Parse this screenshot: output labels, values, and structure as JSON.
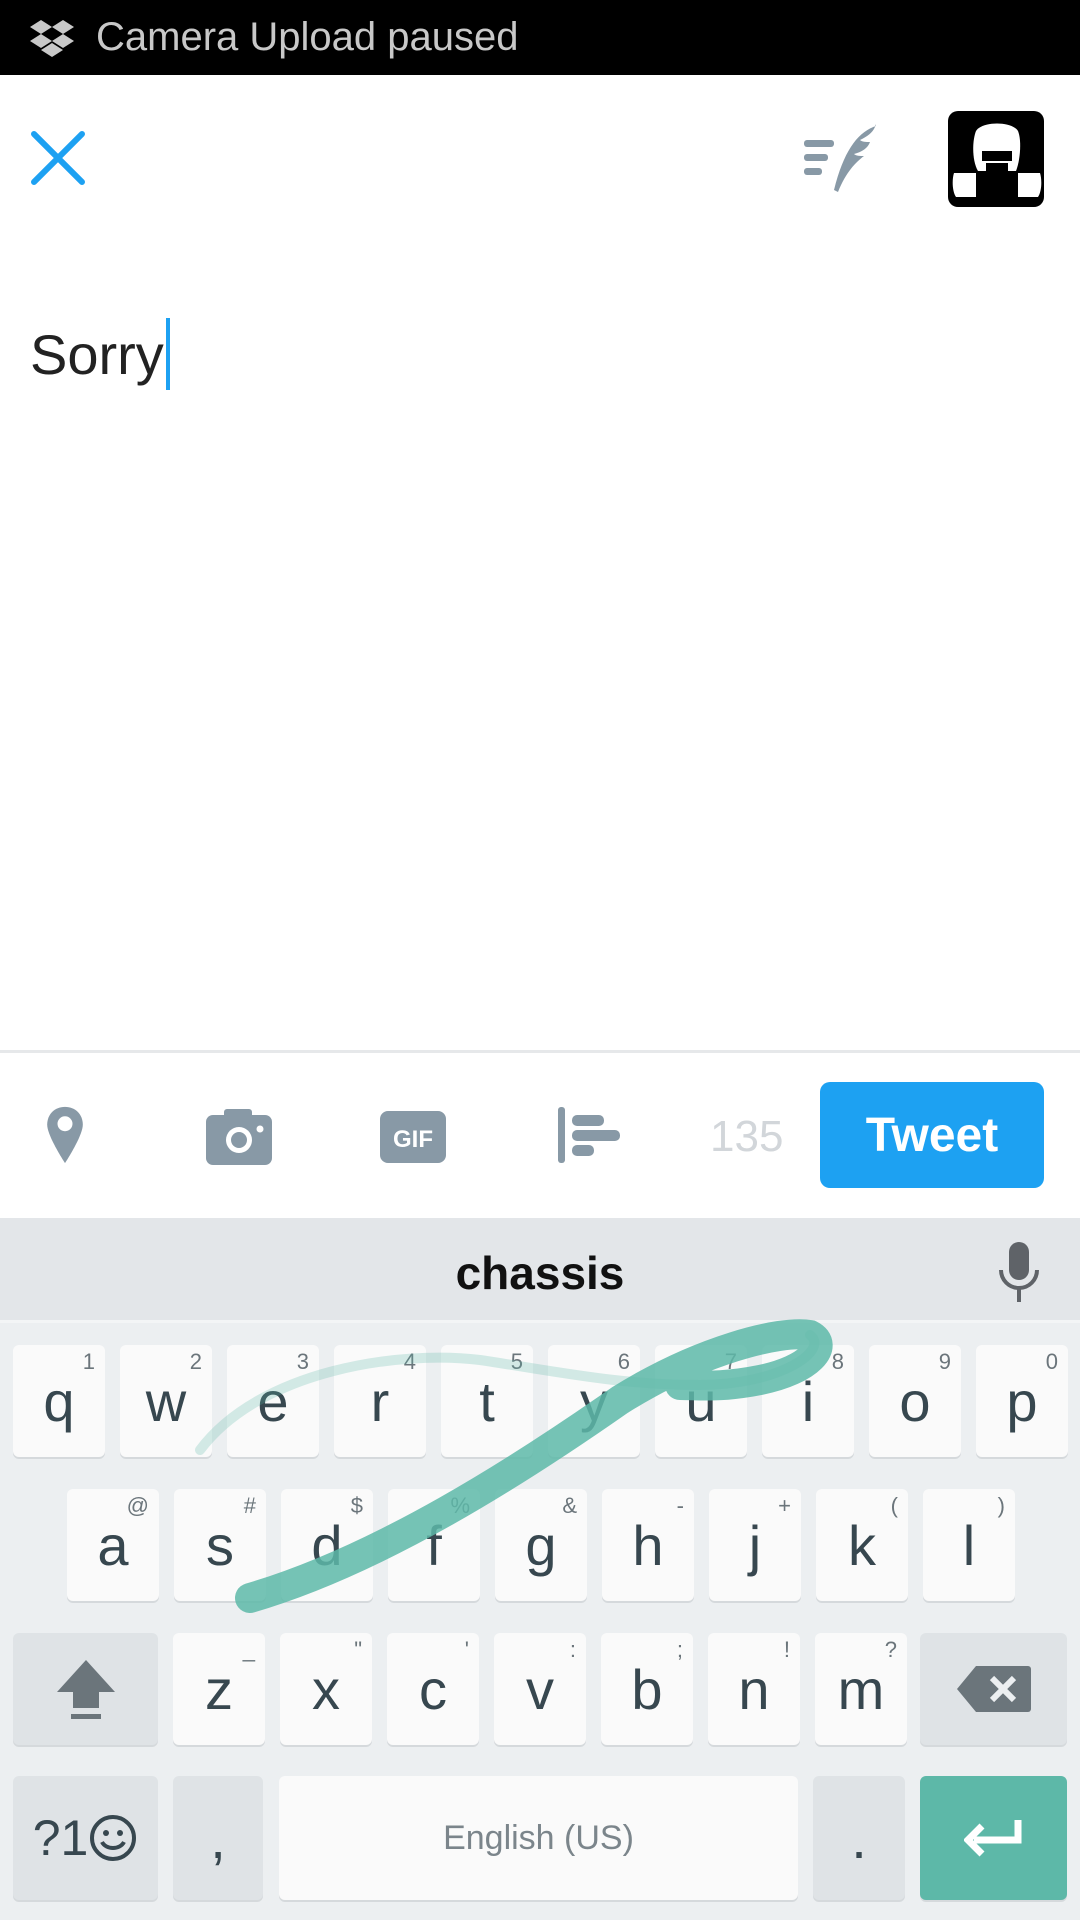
{
  "status_bar": {
    "icon": "dropbox-icon",
    "text": "Camera Upload paused"
  },
  "header": {
    "close_icon": "close-icon",
    "drafts_icon": "drafts-quill-icon",
    "avatar": "user-avatar"
  },
  "compose": {
    "text": "Sorry"
  },
  "toolbar": {
    "icons": [
      "location-pin-icon",
      "camera-icon",
      "gif-icon",
      "poll-icon"
    ],
    "char_count": "135",
    "tweet_label": "Tweet"
  },
  "keyboard": {
    "suggestion": "chassis",
    "rows": [
      [
        {
          "k": "q",
          "h": "1"
        },
        {
          "k": "w",
          "h": "2"
        },
        {
          "k": "e",
          "h": "3"
        },
        {
          "k": "r",
          "h": "4"
        },
        {
          "k": "t",
          "h": "5"
        },
        {
          "k": "y",
          "h": "6"
        },
        {
          "k": "u",
          "h": "7"
        },
        {
          "k": "i",
          "h": "8"
        },
        {
          "k": "o",
          "h": "9"
        },
        {
          "k": "p",
          "h": "0"
        }
      ],
      [
        {
          "k": "a",
          "h": "@"
        },
        {
          "k": "s",
          "h": "#"
        },
        {
          "k": "d",
          "h": "$"
        },
        {
          "k": "f",
          "h": "%"
        },
        {
          "k": "g",
          "h": "&"
        },
        {
          "k": "h",
          "h": "-"
        },
        {
          "k": "j",
          "h": "+"
        },
        {
          "k": "k",
          "h": "("
        },
        {
          "k": "l",
          "h": ")"
        }
      ],
      [
        {
          "k": "z",
          "h": "_"
        },
        {
          "k": "x",
          "h": "\""
        },
        {
          "k": "c",
          "h": "'"
        },
        {
          "k": "v",
          "h": ":"
        },
        {
          "k": "b",
          "h": ";"
        },
        {
          "k": "n",
          "h": "!"
        },
        {
          "k": "m",
          "h": "?"
        }
      ]
    ],
    "symbols_label": "?1",
    "comma": ",",
    "space_label": "English (US)",
    "period": ".",
    "accent_color": "#5db8a8"
  }
}
